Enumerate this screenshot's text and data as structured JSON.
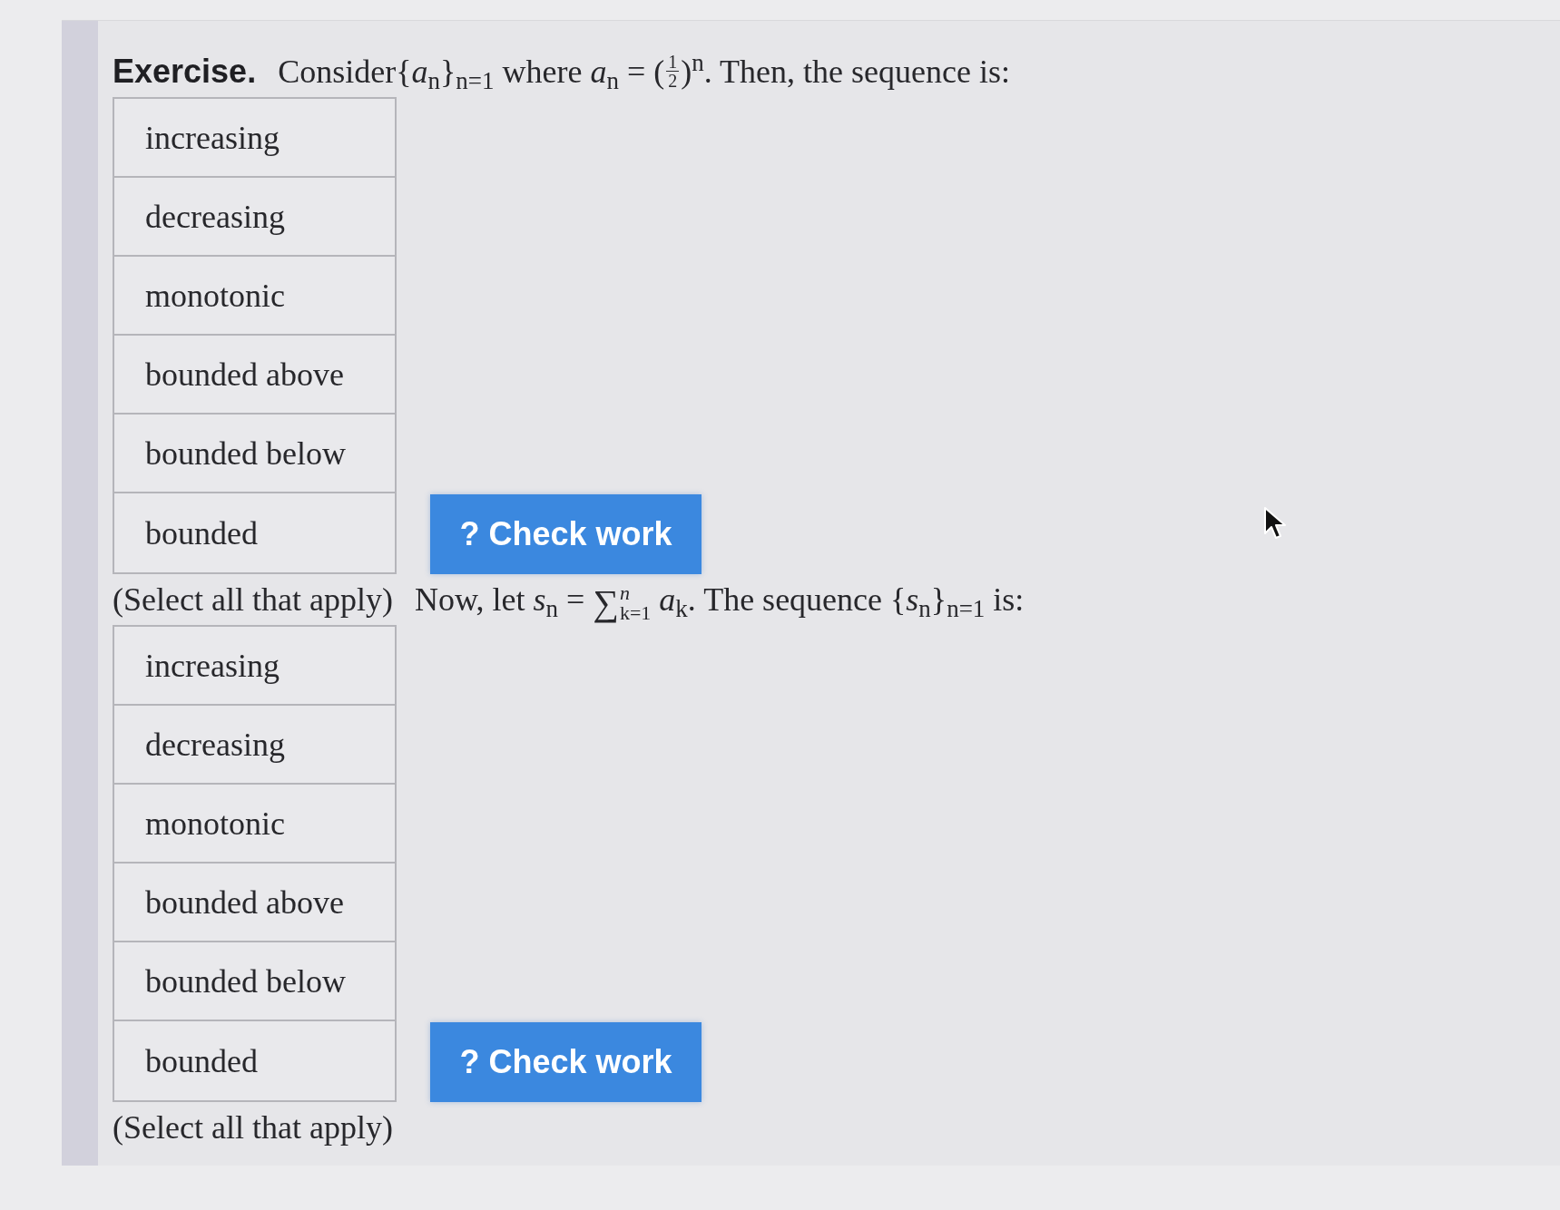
{
  "exercise_label": "Exercise.",
  "questions": [
    {
      "prompt": [
        {
          "kind": "text",
          "text": "Consider{*a*$_{n}$}$_{n=1}$ where *a*$_{n}$ = ("
        },
        {
          "kind": "fraction",
          "numerator": "1",
          "denominator": "2"
        },
        {
          "kind": "text",
          "text": ")$^{n}$. Then, the sequence is:"
        }
      ],
      "options": [
        "increasing",
        "decreasing",
        "monotonic",
        "bounded above",
        "bounded below",
        "bounded"
      ],
      "button": "? Check work",
      "hint": "(Select all that apply)"
    },
    {
      "prompt": [
        {
          "kind": "text",
          "text": "Now, let *s*$_{n}$ = "
        },
        {
          "kind": "sum",
          "symbol": "∑",
          "upper": "n",
          "lower": "k=1"
        },
        {
          "kind": "text",
          "text": " *a*$_{k}$. The sequence {*s*$_{n}$}$_{n=1}$ is:"
        }
      ],
      "options": [
        "increasing",
        "decreasing",
        "monotonic",
        "bounded above",
        "bounded below",
        "bounded"
      ],
      "button": "? Check work",
      "hint": "(Select all that apply)"
    }
  ]
}
